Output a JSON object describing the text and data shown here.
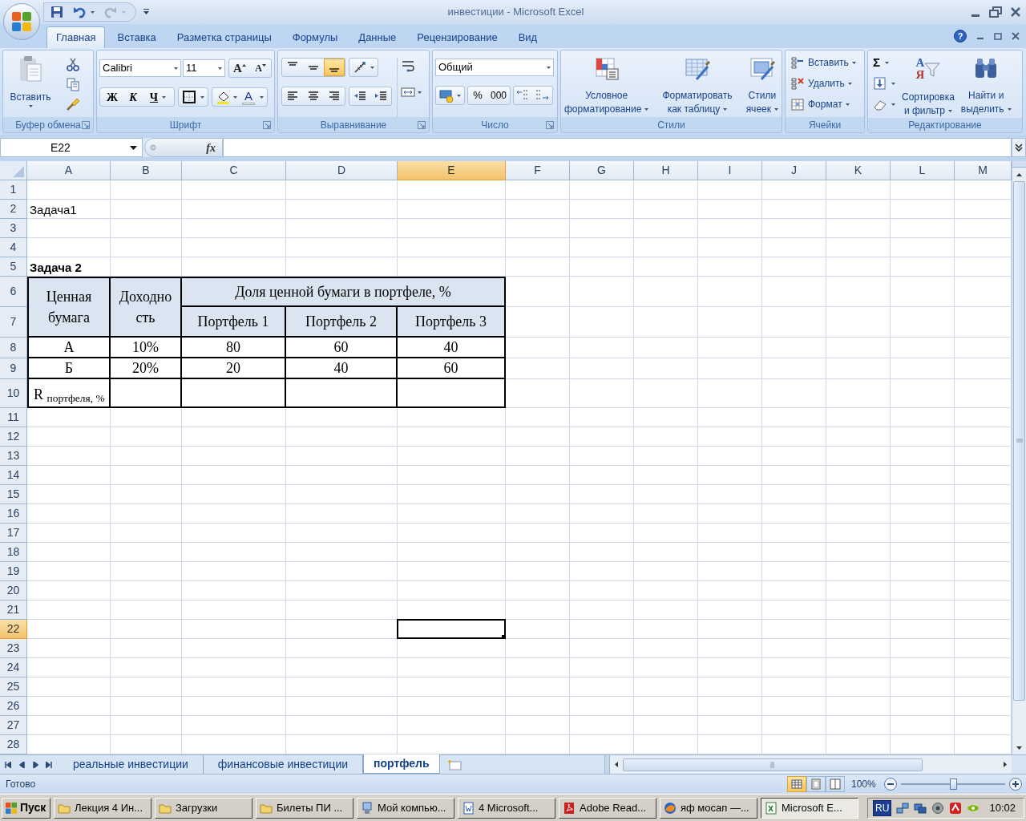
{
  "window": {
    "title": "инвестиции - Microsoft Excel",
    "help": "?"
  },
  "ribbon_tabs": [
    {
      "label": "Главная",
      "selected": true
    },
    {
      "label": "Вставка",
      "selected": false
    },
    {
      "label": "Разметка страницы",
      "selected": false
    },
    {
      "label": "Формулы",
      "selected": false
    },
    {
      "label": "Данные",
      "selected": false
    },
    {
      "label": "Рецензирование",
      "selected": false
    },
    {
      "label": "Вид",
      "selected": false
    }
  ],
  "ribbon": {
    "clipboard": {
      "label": "Буфер обмена",
      "paste": "Вставить"
    },
    "font": {
      "label": "Шрифт",
      "font_name": "Calibri",
      "font_size": "11",
      "grow": "A",
      "shrink": "A",
      "bold": "Ж",
      "italic": "К",
      "underline": "Ч",
      "font_color": "A"
    },
    "alignment": {
      "label": "Выравнивание",
      "vertical": [
        {
          "selected": false
        },
        {
          "selected": false
        },
        {
          "selected": true
        }
      ]
    },
    "number": {
      "label": "Число",
      "format": "Общий",
      "percent": "%",
      "thousands": "000"
    },
    "styles": {
      "label": "Стили",
      "buttons": [
        "Условное\nформатирование",
        "Форматировать\nкак таблицу",
        "Стили\nячеек"
      ]
    },
    "cells": {
      "label": "Ячейки",
      "buttons": [
        "Вставить",
        "Удалить",
        "Формат"
      ]
    },
    "editing": {
      "label": "Редактирование",
      "sum": "Σ",
      "sort_letters": [
        "А",
        "Я"
      ],
      "buttons": [
        "Сортировка\nи фильтр",
        "Найти и\nвыделить"
      ]
    }
  },
  "formula_bar": {
    "name_box": "E22",
    "function_label": "fx"
  },
  "sheet": {
    "columns": [
      {
        "label": "A",
        "selected": false
      },
      {
        "label": "B",
        "selected": false
      },
      {
        "label": "C",
        "selected": false
      },
      {
        "label": "D",
        "selected": false
      },
      {
        "label": "E",
        "selected": true
      },
      {
        "label": "F",
        "selected": false
      },
      {
        "label": "G",
        "selected": false
      },
      {
        "label": "H",
        "selected": false
      },
      {
        "label": "I",
        "selected": false
      },
      {
        "label": "J",
        "selected": false
      },
      {
        "label": "K",
        "selected": false
      },
      {
        "label": "L",
        "selected": false
      },
      {
        "label": "M",
        "selected": false
      }
    ],
    "rows": [
      {
        "label": "1",
        "selected": false
      },
      {
        "label": "2",
        "selected": false,
        "text": "Задача1",
        "bold": false
      },
      {
        "label": "3",
        "selected": false
      },
      {
        "label": "4",
        "selected": false
      },
      {
        "label": "5",
        "selected": false,
        "text": "Задача 2",
        "bold": true
      },
      {
        "label": "6",
        "selected": false
      },
      {
        "label": "7",
        "selected": false
      },
      {
        "label": "8",
        "selected": false
      },
      {
        "label": "9",
        "selected": false
      },
      {
        "label": "10",
        "selected": false
      },
      {
        "label": "11",
        "selected": false
      },
      {
        "label": "12",
        "selected": false
      },
      {
        "label": "13",
        "selected": false
      },
      {
        "label": "14",
        "selected": false
      },
      {
        "label": "15",
        "selected": false
      },
      {
        "label": "16",
        "selected": false
      },
      {
        "label": "17",
        "selected": false
      },
      {
        "label": "18",
        "selected": false
      },
      {
        "label": "19",
        "selected": false
      },
      {
        "label": "20",
        "selected": false
      },
      {
        "label": "21",
        "selected": false
      },
      {
        "label": "22",
        "selected": true
      },
      {
        "label": "23",
        "selected": false
      },
      {
        "label": "24",
        "selected": false
      },
      {
        "label": "25",
        "selected": false
      },
      {
        "label": "26",
        "selected": false
      },
      {
        "label": "27",
        "selected": false
      },
      {
        "label": "28",
        "selected": false
      }
    ],
    "table": {
      "row_headers": [
        "Ценная\nбумага",
        "Доходно\nсть"
      ],
      "group_header": "Доля ценной бумаги в портфеле, %",
      "column_headers": [
        "Портфель 1",
        "Портфель 2",
        "Портфель 3"
      ],
      "rows": [
        [
          "А",
          "10%",
          "80",
          "60",
          "40"
        ],
        [
          "Б",
          "20%",
          "20",
          "40",
          "60"
        ]
      ],
      "total_row": {
        "label": "R $_{портфеля, %}$"
      }
    }
  },
  "sheet_tabs": [
    {
      "label": "реальные инвестиции",
      "selected": false
    },
    {
      "label": "финансовые инвестиции",
      "selected": false
    },
    {
      "label": "портфель",
      "selected": true
    }
  ],
  "status_bar": {
    "status": "Готово",
    "zoom": "100%",
    "zoom_slider": {
      "level": 0.5
    },
    "views": [
      {
        "selected": true
      },
      {
        "selected": false
      },
      {
        "selected": false
      }
    ]
  },
  "taskbar": {
    "start": "Пуск",
    "items": [
      {
        "label": "Лекция 4 Ин...",
        "kind": "folder",
        "selected": false
      },
      {
        "label": "Загрузки",
        "kind": "folder",
        "selected": false
      },
      {
        "label": "Билеты ПИ ...",
        "kind": "folder",
        "selected": false
      },
      {
        "label": "Мой компью...",
        "kind": "computer",
        "selected": false
      },
      {
        "label": "4 Microsoft...",
        "kind": "word",
        "selected": false
      },
      {
        "label": "Adobe Read...",
        "kind": "pdf",
        "selected": false
      },
      {
        "label": "яф мосап —...",
        "kind": "browser",
        "selected": false
      },
      {
        "label": "Microsoft E...",
        "kind": "excel",
        "selected": true
      }
    ],
    "language": "RU",
    "clock": "10:02"
  }
}
